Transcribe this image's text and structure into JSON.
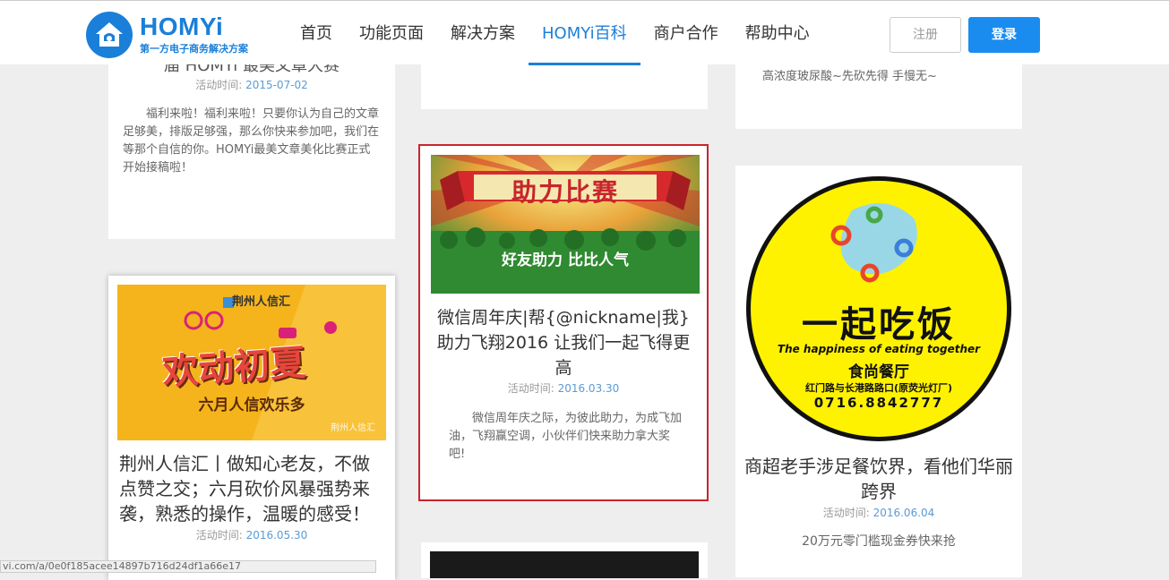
{
  "header": {
    "logo_title": "HOMYi",
    "logo_subtitle": "第一方电子商务解决方案",
    "nav": [
      "首页",
      "功能页面",
      "解决方案",
      "HOMYi百科",
      "商户合作",
      "帮助中心"
    ],
    "register_label": "注册",
    "login_label": "登录"
  },
  "cards": {
    "c1": {
      "title_partial": "届 HOMYi 最美文章大赛",
      "date_label": "活动时间:",
      "date": "2015-07-02",
      "desc": "福利来啦！福利来啦！只要你认为自己的文章足够美，排版足够强，那么你快来参加吧，我们在等那个自信的你。HOMYi最美文章美化比赛正式开始接稿啦！"
    },
    "c3_top": {
      "desc": "高浓度玻尿酸~先砍先得 手慢无~"
    },
    "c2": {
      "banner_title": "助力比赛",
      "banner_sub": "好友助力 比比人气",
      "title": "微信周年庆|帮{@nickname|我}助力飞翔2016 让我们一起飞得更高",
      "date_label": "活动时间:",
      "date": "2016.03.30",
      "desc": "微信周年庆之际，为彼此助力，为成飞加油，飞翔赢空调，小伙伴们快来助力拿大奖吧!"
    },
    "c4": {
      "brand": "荆州人信汇",
      "banner_title": "欢动初夏",
      "banner_sub": "六月人信欢乐多",
      "watermark": "荆州人信汇",
      "title": "荆州人信汇丨做知心老友，不做点赞之交；六月砍价风暴强势来袭，熟悉的操作，温暖的感受！",
      "date_label": "活动时间:",
      "date": "2016.05.30"
    },
    "c5": {
      "logo_title": "一起吃饭",
      "logo_en": "The happiness of eating together",
      "logo_shop": "食尚餐厅",
      "logo_addr": "红门路与长港路路口(原荧光灯厂)",
      "logo_phone": "0716.8842777",
      "title": "商超老手涉足餐饮界，看他们华丽跨界",
      "date_label": "活动时间:",
      "date": "2016.06.04",
      "desc": "20万元零门槛现金券快来抢"
    }
  },
  "status_url": "vi.com/a/0e0f185acee14897b716d24df1a66e17"
}
